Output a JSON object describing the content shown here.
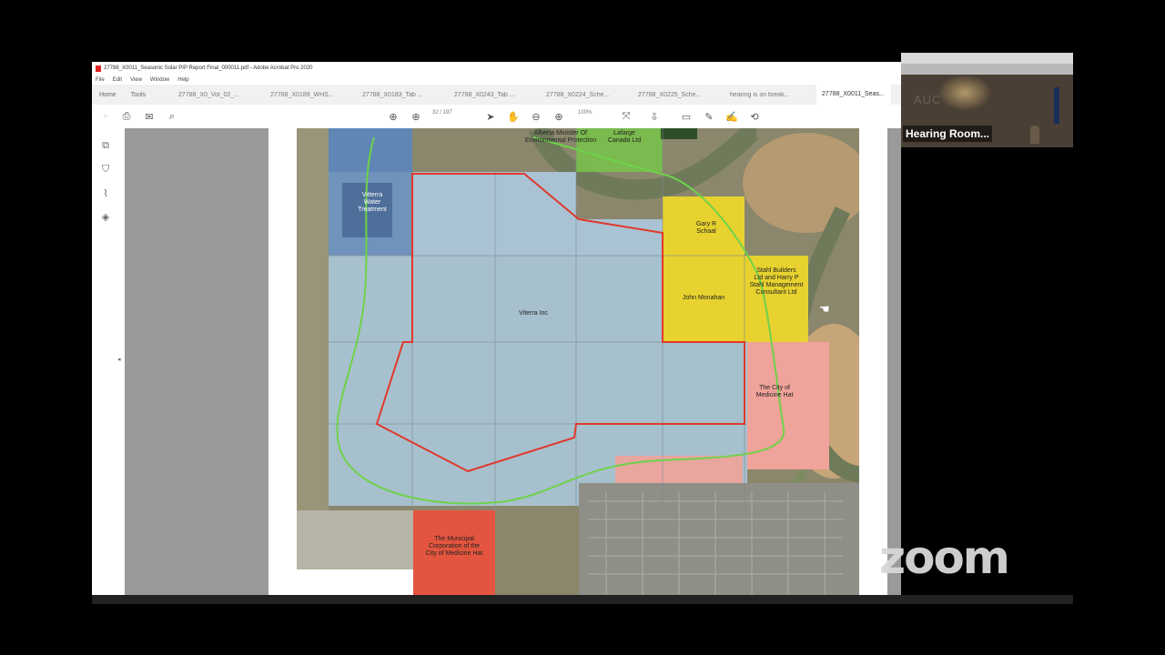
{
  "window": {
    "title": "27788_X0011_Seasonic Solar PIP Report Final_000011.pdf - Adobe Acrobat Pro 2020"
  },
  "menu": [
    "File",
    "Edit",
    "View",
    "Window",
    "Help"
  ],
  "nav": {
    "home": "Home",
    "tools": "Tools"
  },
  "tabs": [
    {
      "label": "27788_X0_Vol_02_..."
    },
    {
      "label": "27788_X0189_WHS..."
    },
    {
      "label": "27788_X0183_Tab ..."
    },
    {
      "label": "27788_X0243_Tab ..."
    },
    {
      "label": "27788_X0224_Sche..."
    },
    {
      "label": "27788_X0225_Sche..."
    },
    {
      "label": "hearing is on break..."
    },
    {
      "label": "27788_X0011_Seas...",
      "active": true
    }
  ],
  "toolbar": {
    "page_current": "32",
    "page_total": "/ 197",
    "zoom": "100%"
  },
  "map": {
    "labels": {
      "env": "Alberta Minister Of\nEnvironmental Protection",
      "top_right": "Lafarge\nCanada Ltd",
      "water": "Vitterra\nWater\nTreatment",
      "gary": "Gary R\nSchaal",
      "stahl": "Stahl Builders\nLtd and Harry P\nStahl Management\nConsultant Ltd",
      "john": "John Monahan",
      "viterra": "Viterra Inc",
      "city": "The City of\nMedicine Hat",
      "municipal": "The Municipal\nCorporation of the\nCity of Medicine Hat"
    },
    "colors": {
      "boundary": "#e0392b",
      "buffer": "#6fd24a",
      "yellow": "#e8d22f",
      "pink": "#f0a39a",
      "red": "#e4553f",
      "blue": "#5f86b5",
      "light_blue": "#a9c3d4"
    }
  },
  "video": {
    "participant": "Hearing Room...",
    "wall_sign": "AUC"
  },
  "watermark": "zoom"
}
